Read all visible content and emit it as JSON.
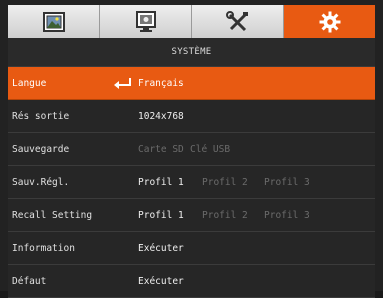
{
  "tabs": [
    {
      "icon": "picture-icon",
      "active": false
    },
    {
      "icon": "monitor-video-icon",
      "active": false
    },
    {
      "icon": "tools-icon",
      "active": false
    },
    {
      "icon": "gear-icon",
      "active": true
    }
  ],
  "title": "SYSTÈME",
  "accent_color": "#e85a12",
  "rows": [
    {
      "label": "Langue",
      "options": [
        {
          "text": "Français",
          "on": true
        }
      ],
      "selected": true
    },
    {
      "label": "Rés sortie",
      "options": [
        {
          "text": "1024x768",
          "on": true
        }
      ]
    },
    {
      "label": "Sauvegarde",
      "options": [
        {
          "text": "Carte SD",
          "on": false
        },
        {
          "text": "Clé USB",
          "on": false
        }
      ]
    },
    {
      "label": "Sauv.Régl.",
      "options": [
        {
          "text": "Profil 1",
          "on": true
        },
        {
          "text": "Profil 2",
          "on": false
        },
        {
          "text": "Profil 3",
          "on": false
        }
      ]
    },
    {
      "label": "Recall Setting",
      "options": [
        {
          "text": "Profil 1",
          "on": true
        },
        {
          "text": "Profil 2",
          "on": false
        },
        {
          "text": "Profil 3",
          "on": false
        }
      ]
    },
    {
      "label": "Information",
      "options": [
        {
          "text": "Exécuter",
          "on": true
        }
      ]
    },
    {
      "label": "Défaut",
      "options": [
        {
          "text": "Exécuter",
          "on": true
        }
      ]
    }
  ]
}
